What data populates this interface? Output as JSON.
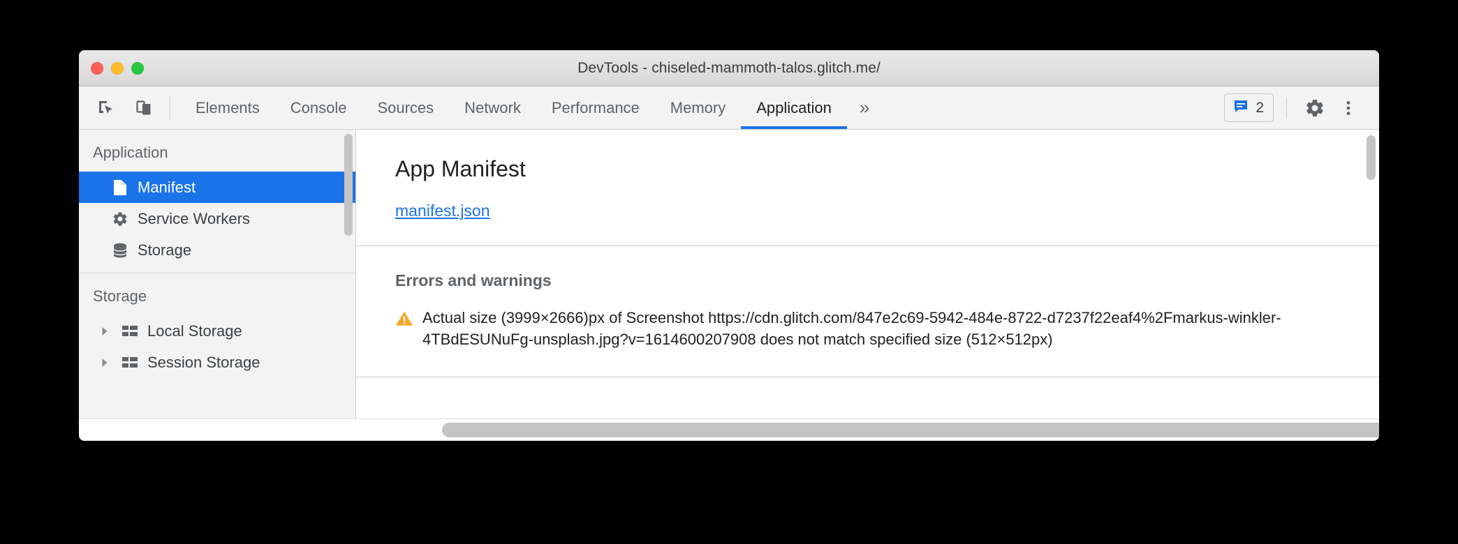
{
  "window": {
    "title": "DevTools - chiseled-mammoth-talos.glitch.me/",
    "traffic_lights": {
      "close": "close-button",
      "minimize": "minimize-button",
      "maximize": "maximize-button"
    }
  },
  "toolbar": {
    "inspect_icon": "inspect-element-icon",
    "device_icon": "device-toolbar-icon",
    "tabs": [
      {
        "label": "Elements",
        "active": false
      },
      {
        "label": "Console",
        "active": false
      },
      {
        "label": "Sources",
        "active": false
      },
      {
        "label": "Network",
        "active": false
      },
      {
        "label": "Performance",
        "active": false
      },
      {
        "label": "Memory",
        "active": false
      },
      {
        "label": "Application",
        "active": true
      }
    ],
    "more_tabs_label": "»",
    "messages": {
      "icon": "message-icon",
      "count": "2",
      "color": "#1a73e8"
    },
    "settings_icon": "gear-icon",
    "more_options_icon": "kebab-menu-icon"
  },
  "sidebar": {
    "groups": [
      {
        "title": "Application",
        "items": [
          {
            "label": "Manifest",
            "icon": "document-icon",
            "selected": true,
            "twisty": false
          },
          {
            "label": "Service Workers",
            "icon": "gear-icon",
            "selected": false,
            "twisty": false
          },
          {
            "label": "Storage",
            "icon": "database-icon",
            "selected": false,
            "twisty": false
          }
        ]
      },
      {
        "title": "Storage",
        "items": [
          {
            "label": "Local Storage",
            "icon": "table-icon",
            "selected": false,
            "twisty": true
          },
          {
            "label": "Session Storage",
            "icon": "table-icon",
            "selected": false,
            "twisty": true
          }
        ]
      }
    ],
    "selected_color": "#1a73e8"
  },
  "main": {
    "title": "App Manifest",
    "manifest_link": "manifest.json",
    "errors_section_title": "Errors and warnings",
    "warning": {
      "icon": "warning-triangle-icon",
      "icon_color": "#f5a623",
      "text": "Actual size (3999×2666)px of Screenshot https://cdn.glitch.com/847e2c69-5942-484e-8722-d7237f22eaf4%2Fmarkus-winkler-4TBdESUNuFg-unsplash.jpg?v=1614600207908 does not match specified size (512×512px)"
    }
  }
}
